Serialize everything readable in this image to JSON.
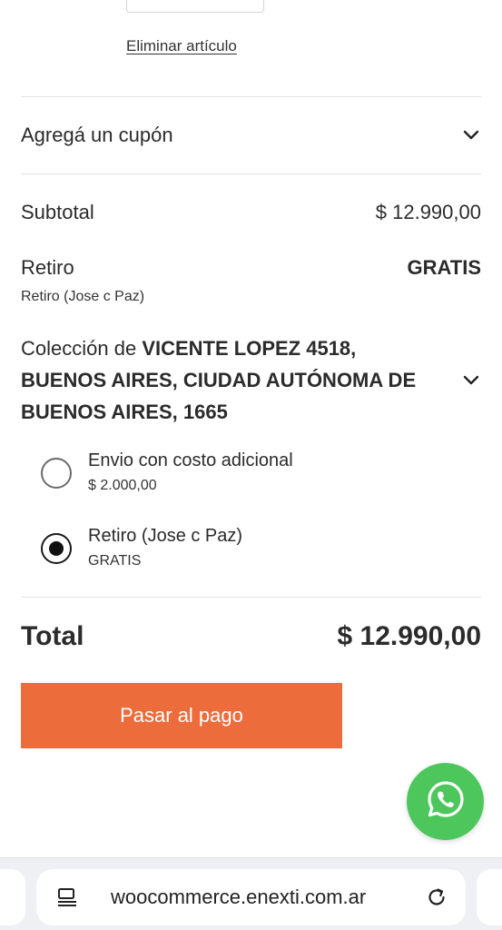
{
  "cart_item": {
    "remove_label": "Eliminar artículo"
  },
  "coupon": {
    "label": "Agregá un cupón",
    "icon": "chevron-down-icon"
  },
  "summary": {
    "subtotal_label": "Subtotal",
    "subtotal_value": "$ 12.990,00",
    "shipping_label": "Retiro",
    "shipping_value": "GRATIS",
    "shipping_note": "Retiro (Jose c Paz)"
  },
  "collection": {
    "prefix": "Colección de ",
    "address": "VICENTE LOPEZ 4518, BUENOS AIRES, CIUDAD AUTÓNOMA DE BUENOS AIRES, 1665"
  },
  "shipping_options": [
    {
      "title": "Envio con costo adicional",
      "price": "$ 2.000,00",
      "selected": false
    },
    {
      "title": "Retiro (Jose c Paz)",
      "price": "GRATIS",
      "selected": true
    }
  ],
  "total": {
    "label": "Total",
    "value": "$ 12.990,00"
  },
  "checkout": {
    "button_label": "Pasar al pago",
    "color": "#ec6d3b"
  },
  "whatsapp": {
    "icon": "whatsapp-icon",
    "color": "#4dc75c"
  },
  "browser": {
    "url": "woocommerce.enexti.com.ar",
    "left_icon": "page-info-icon",
    "right_icon": "reload-icon"
  }
}
